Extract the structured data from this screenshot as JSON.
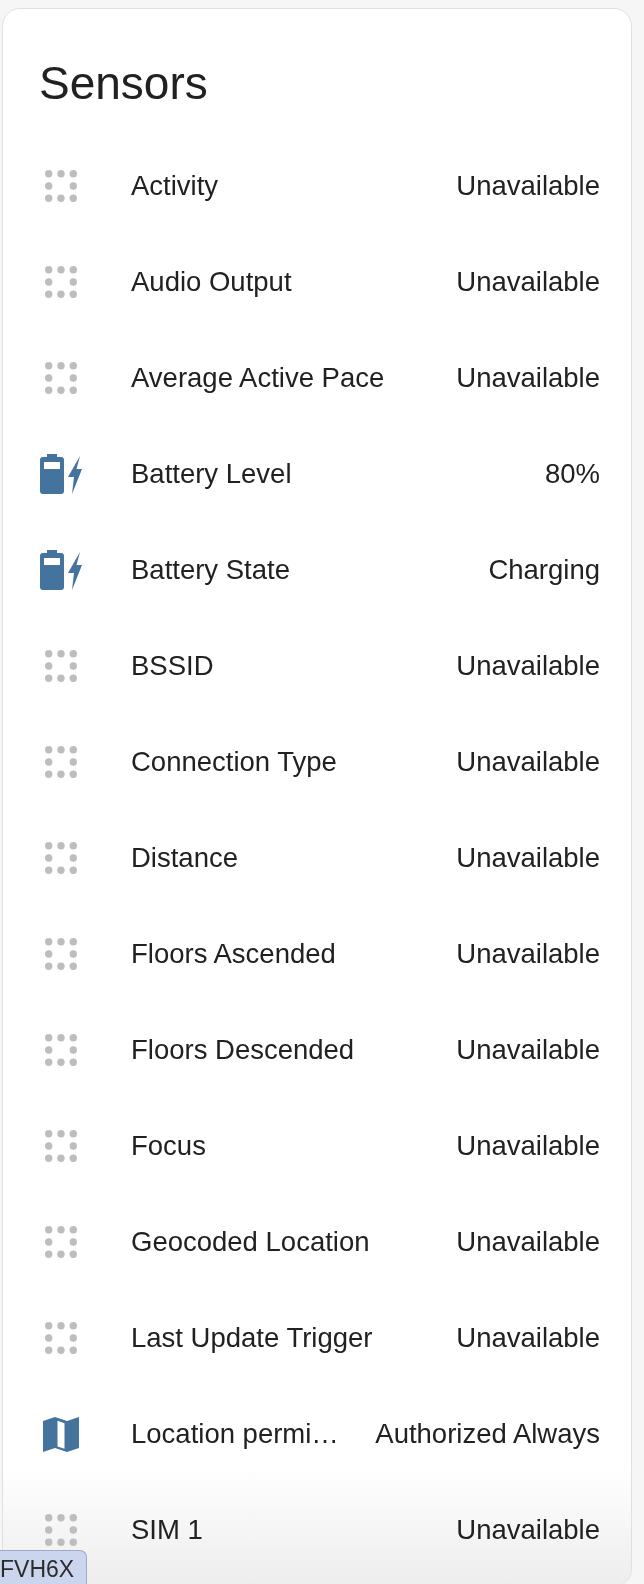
{
  "card": {
    "title": "Sensors",
    "rows": [
      {
        "kind": "generic",
        "name": "Activity",
        "value": "Unavailable"
      },
      {
        "kind": "generic",
        "name": "Audio Output",
        "value": "Unavailable"
      },
      {
        "kind": "generic",
        "name": "Average Active Pace",
        "value": "Unavailable"
      },
      {
        "kind": "battery",
        "name": "Battery Level",
        "value": "80%"
      },
      {
        "kind": "battery",
        "name": "Battery State",
        "value": "Charging"
      },
      {
        "kind": "generic",
        "name": "BSSID",
        "value": "Unavailable"
      },
      {
        "kind": "generic",
        "name": "Connection Type",
        "value": "Unavailable"
      },
      {
        "kind": "generic",
        "name": "Distance",
        "value": "Unavailable"
      },
      {
        "kind": "generic",
        "name": "Floors Ascended",
        "value": "Unavailable"
      },
      {
        "kind": "generic",
        "name": "Floors Descended",
        "value": "Unavailable"
      },
      {
        "kind": "generic",
        "name": "Focus",
        "value": "Unavailable"
      },
      {
        "kind": "generic",
        "name": "Geocoded Location",
        "value": "Unavailable"
      },
      {
        "kind": "generic",
        "name": "Last Update Trigger",
        "value": "Unavailable"
      },
      {
        "kind": "map",
        "name": "Location permi…",
        "value": "Authorized Always"
      },
      {
        "kind": "generic",
        "name": "SIM 1",
        "value": "Unavailable"
      }
    ]
  },
  "tag": {
    "text": "FVH6X"
  }
}
